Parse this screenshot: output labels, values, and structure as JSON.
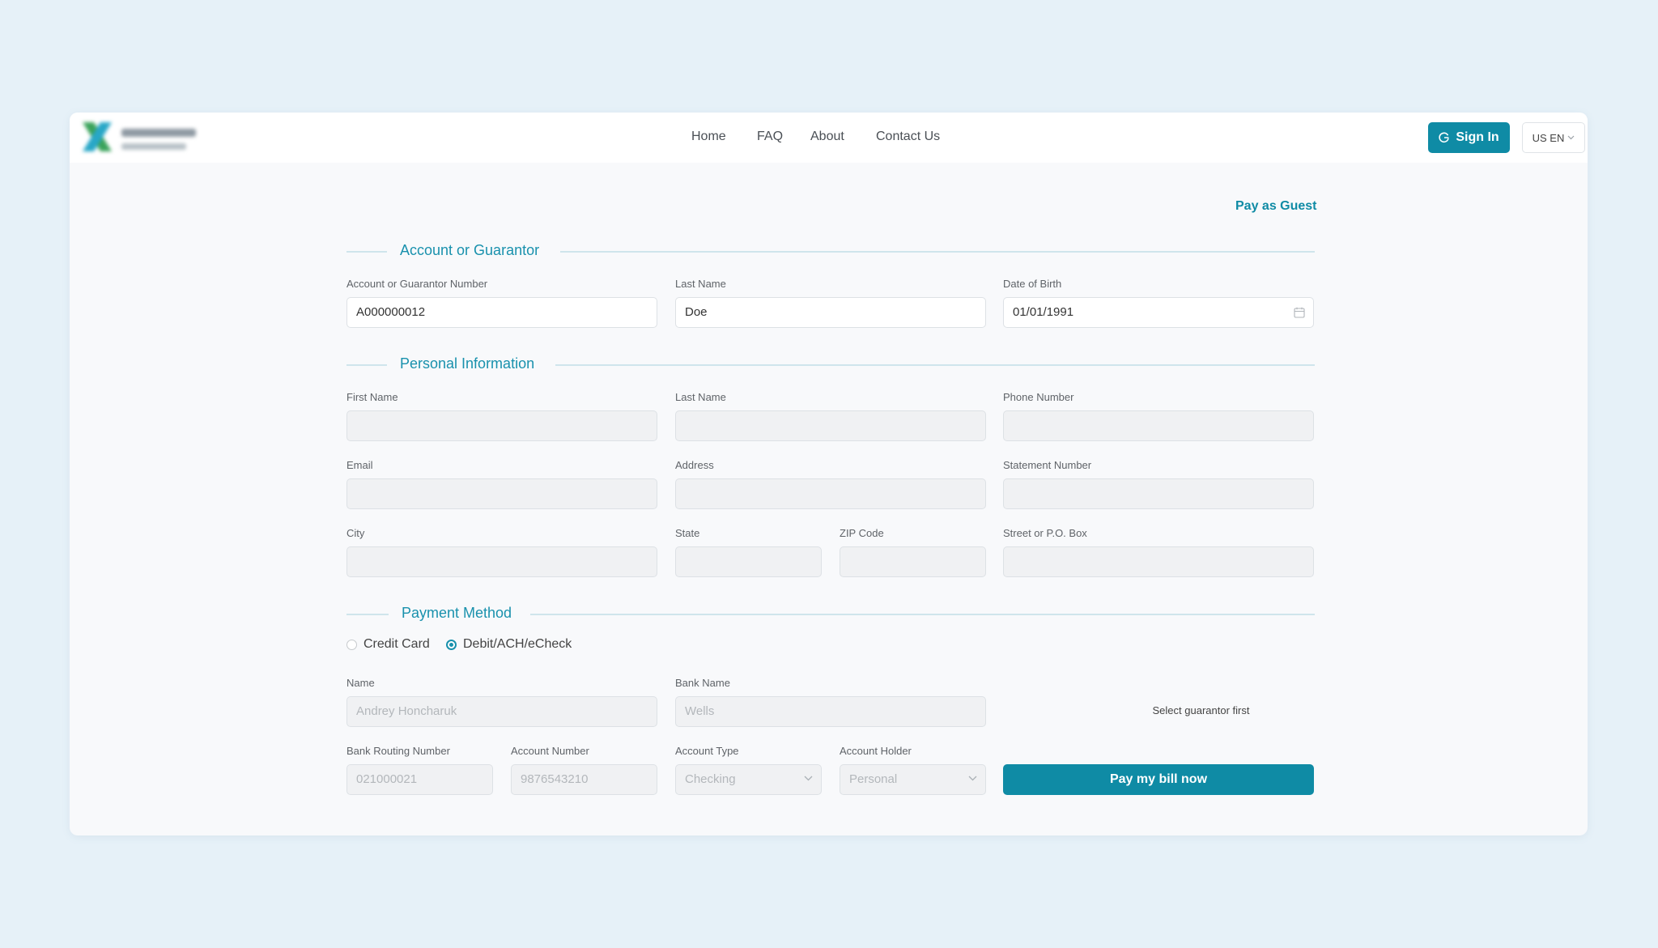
{
  "header": {
    "nav": [
      "Home",
      "FAQ",
      "About",
      "Contact Us"
    ],
    "sign_in_label": "Sign In",
    "language": "US EN"
  },
  "pay_as_guest": "Pay as Guest",
  "sections": {
    "account": {
      "title": "Account or Guarantor",
      "guarantor_number_label": "Account or Guarantor Number",
      "guarantor_number_value": "A000000012",
      "last_name_label": "Last Name",
      "last_name_value": "Doe",
      "dob_label": "Date of Birth",
      "dob_value": "01/01/1991"
    },
    "personal": {
      "title": "Personal Information",
      "first_name_label": "First Name",
      "last_name_label": "Last Name",
      "phone_label": "Phone Number",
      "email_label": "Email",
      "address_label": "Address",
      "statement_label": "Statement Number",
      "city_label": "City",
      "state_label": "State",
      "zip_label": "ZIP Code",
      "street_label": "Street or P.O. Box"
    },
    "payment": {
      "title": "Payment Method",
      "options": [
        "Credit Card",
        "Debit/ACH/eCheck"
      ],
      "selected": "Debit/ACH/eCheck",
      "name_label": "Name",
      "name_value": "Andrey Honcharuk",
      "bank_label": "Bank Name",
      "bank_value": "Wells",
      "hint": "Select guarantor first",
      "routing_label": "Bank Routing Number",
      "routing_value": "021000021",
      "account_number_label": "Account Number",
      "account_number_value": "9876543210",
      "account_type_label": "Account Type",
      "account_type_value": "Checking",
      "holder_label": "Account Holder",
      "holder_value": "Personal",
      "submit_label": "Pay my bill now"
    }
  },
  "colors": {
    "accent": "#0f8ba5",
    "background": "#e6f1f8",
    "card": "#f8f9fb"
  }
}
